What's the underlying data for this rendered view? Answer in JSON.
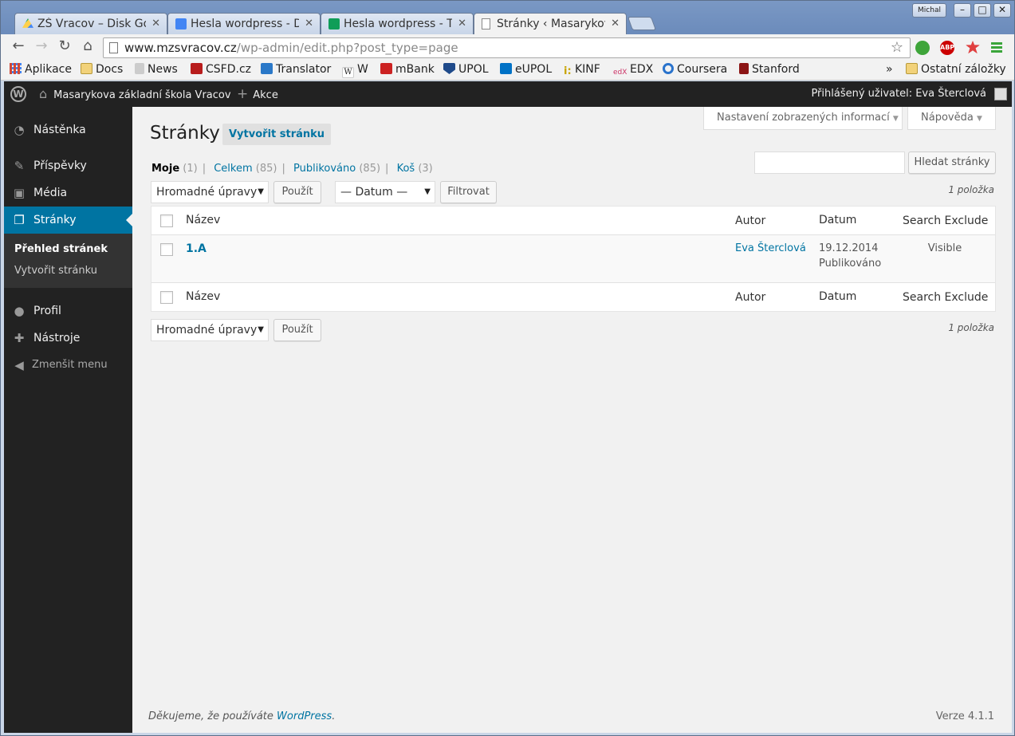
{
  "browser": {
    "tabs": [
      {
        "title": "ZŠ Vracov – Disk Go",
        "icon": "google-drive-icon",
        "active": false
      },
      {
        "title": "Hesla wordpress - D",
        "icon": "google-docs-icon",
        "active": false
      },
      {
        "title": "Hesla wordpress - T",
        "icon": "google-sheets-icon",
        "active": false
      },
      {
        "title": "Stránky ‹ Masarykov",
        "icon": "page-icon",
        "active": true
      }
    ],
    "user_badge": "Michal",
    "url_host": "www.mzsvracov.cz",
    "url_path": "/wp-admin/edit.php?post_type=page",
    "bookmarks": [
      {
        "label": "Aplikace",
        "icon": "apps-grid-icon",
        "color": "#d14836"
      },
      {
        "label": "Docs",
        "icon": "folder-icon",
        "color": "#e8c15a"
      },
      {
        "label": "News",
        "icon": "news-icon",
        "color": "#888888"
      },
      {
        "label": "CSFD.cz",
        "icon": "csfd-icon",
        "color": "#b81c1c"
      },
      {
        "label": "Translator",
        "icon": "translator-icon",
        "color": "#2a78c8"
      },
      {
        "label": "W",
        "icon": "wikipedia-icon",
        "color": "#ffffff"
      },
      {
        "label": "mBank",
        "icon": "mbank-icon",
        "color": "#cc2222"
      },
      {
        "label": "UPOL",
        "icon": "upol-icon",
        "color": "#1f4a8a"
      },
      {
        "label": "eUPOL",
        "icon": "outlook-icon",
        "color": "#0072c6"
      },
      {
        "label": "KINF",
        "icon": "kinf-icon",
        "color": "#c8a400"
      },
      {
        "label": "EDX",
        "icon": "edx-icon",
        "color": "#cc3366"
      },
      {
        "label": "Coursera",
        "icon": "coursera-icon",
        "color": "#2a73cc"
      },
      {
        "label": "Stanford",
        "icon": "stanford-icon",
        "color": "#8c1515"
      }
    ],
    "bookmarks_overflow": "»",
    "other_bookmarks": "Ostatní záložky"
  },
  "adminbar": {
    "site_name": "Masarykova základní škola Vracov",
    "new_label": "Akce",
    "howdy": "Přihlášený uživatel: Eva Šterclová"
  },
  "sidebar": {
    "items": [
      {
        "label": "Nástěnka",
        "icon": "dashboard-icon"
      },
      {
        "label": "Příspěvky",
        "icon": "pin-icon"
      },
      {
        "label": "Média",
        "icon": "media-icon"
      },
      {
        "label": "Stránky",
        "icon": "pages-icon"
      }
    ],
    "submenu": [
      "Přehled stránek",
      "Vytvořit stránku"
    ],
    "items2": [
      {
        "label": "Profil",
        "icon": "user-icon"
      },
      {
        "label": "Nástroje",
        "icon": "wrench-icon"
      }
    ],
    "collapse": "Zmenšit menu"
  },
  "screen": {
    "options": "Nastavení zobrazených informací",
    "help": "Nápověda"
  },
  "page": {
    "title": "Stránky",
    "add_new": "Vytvořit stránku",
    "views": [
      {
        "label": "Moje",
        "count": "(1)"
      },
      {
        "label": "Celkem",
        "count": "(85)"
      },
      {
        "label": "Publikováno",
        "count": "(85)"
      },
      {
        "label": "Koš",
        "count": "(3)"
      }
    ],
    "search_button": "Hledat stránky",
    "bulk_select": "Hromadné úpravy",
    "apply": "Použít",
    "date_select": "— Datum —",
    "filter": "Filtrovat",
    "items_count": "1 položka"
  },
  "table": {
    "columns": [
      "Název",
      "Autor",
      "Datum",
      "Search Exclude"
    ],
    "rows": [
      {
        "title": "1.A",
        "author": "Eva Šterclová",
        "date": "19.12.2014",
        "status": "Publikováno",
        "search_exclude": "Visible"
      }
    ]
  },
  "footer": {
    "thanks": "Děkujeme, že používáte",
    "wp_link": "WordPress",
    "period": ".",
    "version": "Verze 4.1.1"
  },
  "colors": {
    "accent": "#0074a2",
    "sidebar_bg": "#222222",
    "main_bg": "#f1f1f1"
  }
}
